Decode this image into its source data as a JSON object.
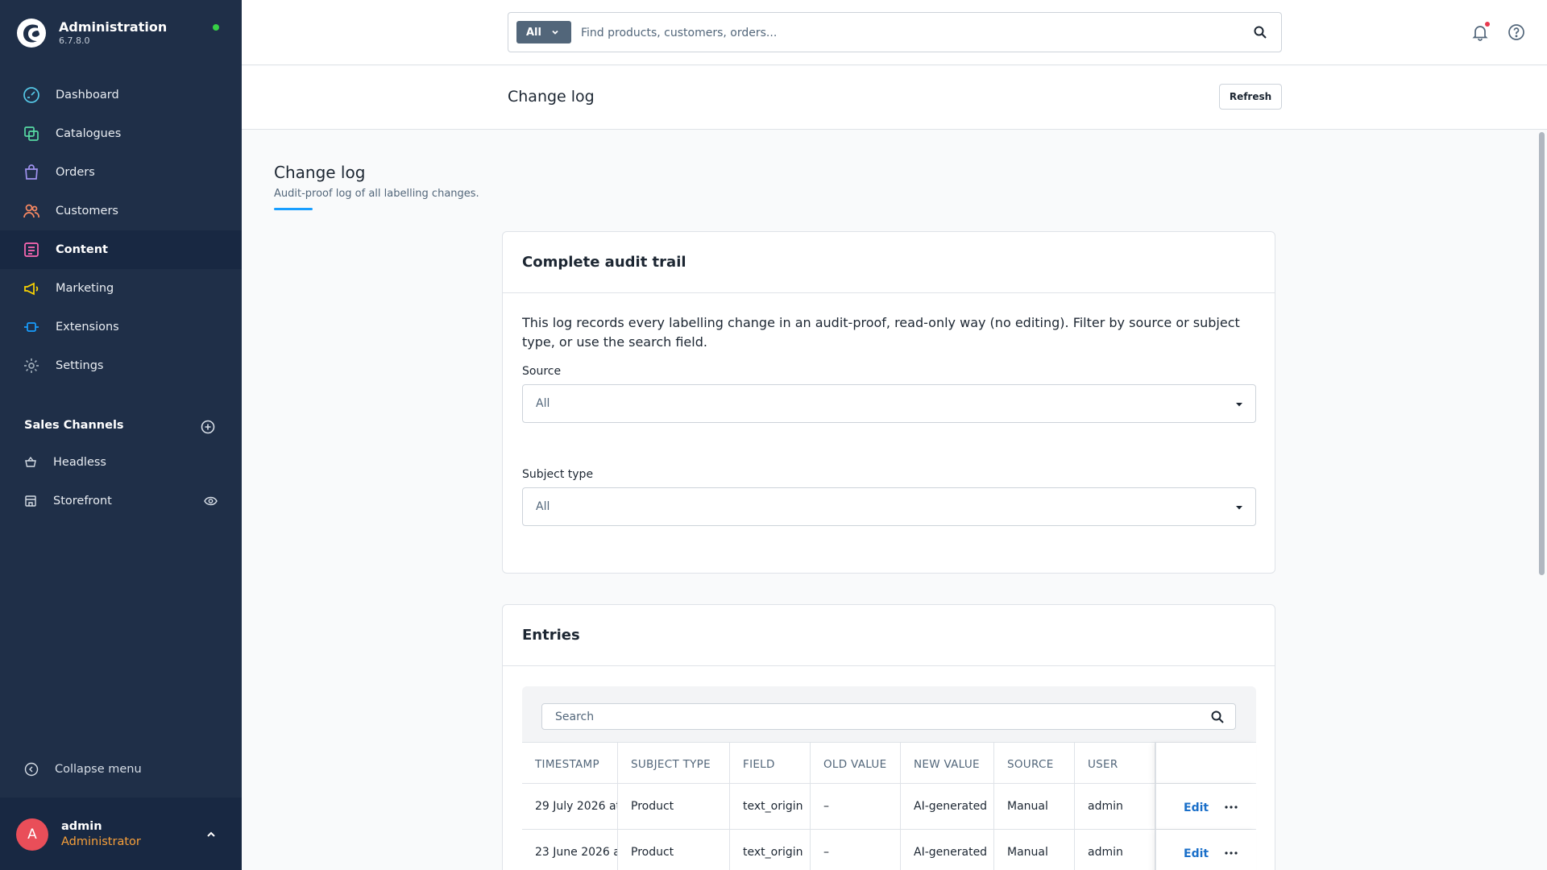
{
  "app": {
    "title": "Administration",
    "version": "6.7.8.0"
  },
  "nav": [
    {
      "label": "Dashboard",
      "icon": "dashboard-icon",
      "color": "#55c7e6",
      "active": false
    },
    {
      "label": "Catalogues",
      "icon": "catalogue-icon",
      "color": "#57d9a3",
      "active": false
    },
    {
      "label": "Orders",
      "icon": "orders-icon",
      "color": "#a092f0",
      "active": false
    },
    {
      "label": "Customers",
      "icon": "customers-icon",
      "color": "#f88962",
      "active": false
    },
    {
      "label": "Content",
      "icon": "content-icon",
      "color": "#ff68b4",
      "active": true
    },
    {
      "label": "Marketing",
      "icon": "marketing-icon",
      "color": "#ffd700",
      "active": false
    },
    {
      "label": "Extensions",
      "icon": "extensions-icon",
      "color": "#189eff",
      "active": false
    },
    {
      "label": "Settings",
      "icon": "settings-icon",
      "color": "#9aa8b5",
      "active": false
    }
  ],
  "sales_channels": {
    "title": "Sales Channels",
    "items": [
      {
        "label": "Headless",
        "icon": "basket-icon"
      },
      {
        "label": "Storefront",
        "icon": "storefront-icon"
      }
    ]
  },
  "collapse_label": "Collapse menu",
  "user": {
    "initial": "A",
    "name": "admin",
    "role": "Administrator"
  },
  "search": {
    "type_label": "All",
    "placeholder": "Find products, customers, orders..."
  },
  "page_header": {
    "title": "Change log",
    "refresh_label": "Refresh"
  },
  "content": {
    "title": "Change log",
    "subtitle": "Audit-proof log of all labelling changes."
  },
  "audit_card": {
    "title": "Complete audit trail",
    "description": "This log records every labelling change in an audit-proof, read-only way (no editing). Filter by source or subject type, or use the search field.",
    "source_label": "Source",
    "source_value": "All",
    "subject_label": "Subject type",
    "subject_value": "All"
  },
  "entries_card": {
    "title": "Entries",
    "search_placeholder": "Search",
    "columns": [
      "TIMESTAMP",
      "SUBJECT TYPE",
      "FIELD",
      "OLD VALUE",
      "NEW VALUE",
      "SOURCE",
      "USER"
    ],
    "rows": [
      {
        "timestamp": "29 July 2026 at",
        "subject_type": "Product",
        "field": "text_origin",
        "old_value": "–",
        "new_value": "AI-generated",
        "source": "Manual",
        "user": "admin",
        "edit": "Edit"
      },
      {
        "timestamp": "23 June 2026 a",
        "subject_type": "Product",
        "field": "text_origin",
        "old_value": "–",
        "new_value": "AI-generated",
        "source": "Manual",
        "user": "admin",
        "edit": "Edit"
      }
    ]
  },
  "colors": {
    "sidebar": "#1f2f48",
    "accent": "#189eff",
    "link": "#1a6fc9",
    "avatar": "#e94e59",
    "role": "#f8a03a",
    "status": "#37d046"
  }
}
